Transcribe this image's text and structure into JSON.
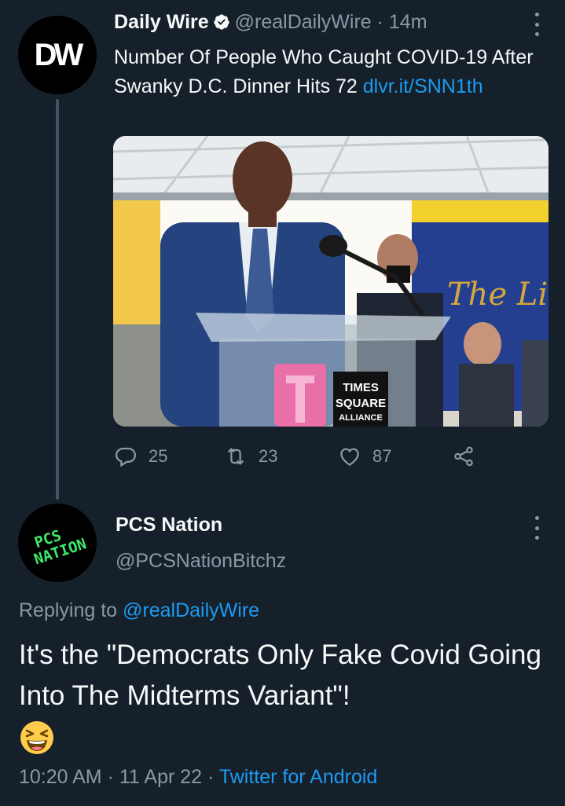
{
  "tweet1": {
    "avatar_text": "DW",
    "author_name": "Daily Wire",
    "handle": "@realDailyWire",
    "separator": "·",
    "time": "14m",
    "text": "Number Of People Who Caught COVID-19 After Swanky D.C. Dinner Hits 72 ",
    "link": "dlvr.it/SNN1th",
    "photo": {
      "sign_line1": "TIMES",
      "sign_line2": "SQUARE",
      "sign_line3": "ALLIANCE",
      "banner_text": "The Little P"
    },
    "actions": {
      "replies": "25",
      "retweets": "23",
      "likes": "87"
    }
  },
  "tweet2": {
    "avatar_line1": "PCS",
    "avatar_line2": "NATION",
    "author_name": "PCS Nation",
    "handle": "@PCSNationBitchz",
    "replying_prefix": "Replying to ",
    "replying_handle": "@realDailyWire",
    "text": "It's the \"Democrats Only Fake Covid Going Into The Midterms Variant\"!",
    "emoji": "😆",
    "time": "10:20 AM",
    "separator1": "·",
    "date": "11 Apr 22",
    "separator2": "·",
    "client": "Twitter for Android"
  },
  "colors": {
    "background": "#15202b",
    "text": "#f7f9f9",
    "muted": "#8b98a5",
    "link": "#1d9bf0"
  },
  "icons": [
    "verified-badge-icon",
    "more-icon",
    "reply-icon",
    "retweet-icon",
    "like-icon",
    "share-icon",
    "laughing-emoji-icon"
  ]
}
